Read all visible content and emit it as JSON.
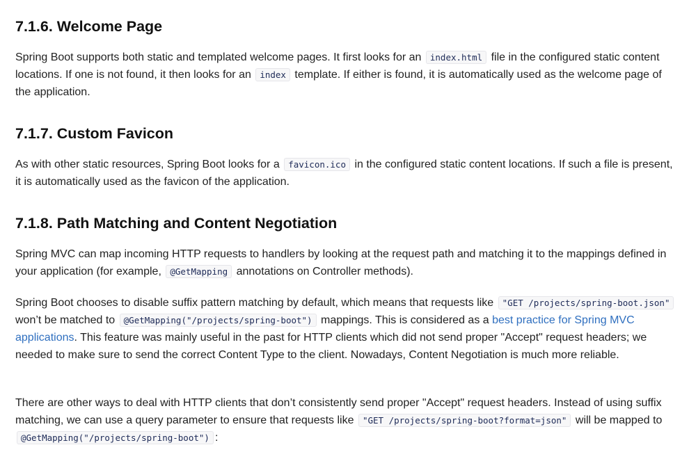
{
  "sections": [
    {
      "heading": "7.1.6. Welcome Page",
      "paragraphs": [
        {
          "t1": "Spring Boot supports both static and templated welcome pages. It first looks for an",
          "c1": "index.html",
          "t2": "file in the configured static content locations. If one is not found, it then looks for an",
          "c2": "index",
          "t3": "template. If either is found, it is automatically used as the welcome page of the application."
        }
      ]
    },
    {
      "heading": "7.1.7. Custom Favicon",
      "paragraphs": [
        {
          "t1": "As with other static resources, Spring Boot looks for a",
          "c1": "favicon.ico",
          "t2": "in the configured static content locations. If such a file is present, it is automatically used as the favicon of the application."
        }
      ]
    },
    {
      "heading": "7.1.8. Path Matching and Content Negotiation",
      "paragraphs": [
        {
          "t1": "Spring MVC can map incoming HTTP requests to handlers by looking at the request path and matching it to the mappings defined in your application (for example,",
          "c1": "@GetMapping",
          "t2": "annotations on Controller methods)."
        },
        {
          "t1": "Spring Boot chooses to disable suffix pattern matching by default, which means that requests like",
          "c1": "\"GET /projects/spring-boot.json\"",
          "t2": "won’t be matched to",
          "c2": "@GetMapping(\"/projects/spring-boot\")",
          "t3": "mappings. This is considered as a",
          "link": "best practice for Spring MVC applications",
          "t4": ". This feature was mainly useful in the past for HTTP clients which did not send proper \"Accept\" request headers; we needed to make sure to send the correct Content Type to the client. Nowadays, Content Negotiation is much more reliable."
        },
        {
          "t1": "There are other ways to deal with HTTP clients that don’t consistently send proper \"Accept\" request headers. Instead of using suffix matching, we can use a query parameter to ensure that requests like",
          "c1": "\"GET /projects/spring-boot?format=json\"",
          "t2": "will be mapped to",
          "c2": "@GetMapping(\"/projects/spring-boot\")",
          "t3": ":"
        }
      ]
    }
  ]
}
